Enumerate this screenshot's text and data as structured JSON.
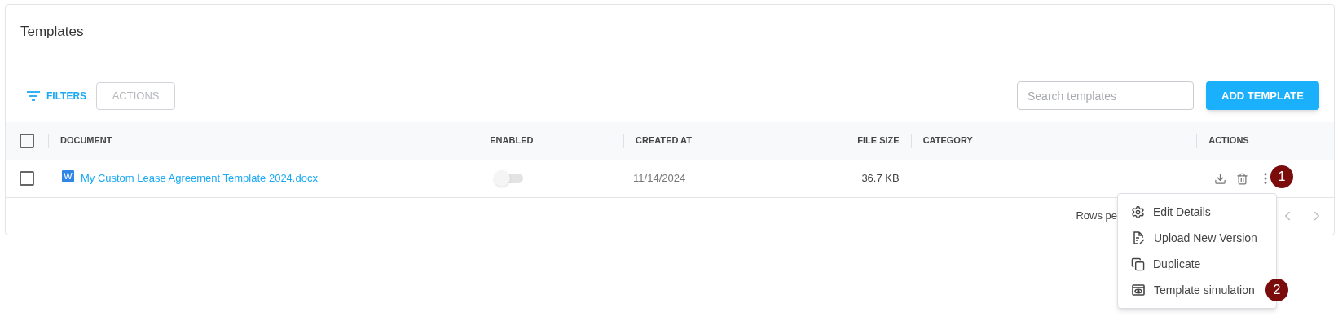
{
  "title": "Templates",
  "toolbar": {
    "filters": "FILTERS",
    "actions": {
      "label": "ACTIONS",
      "disabled": true
    },
    "search": {
      "placeholder": "Search templates"
    },
    "add_button": "ADD TEMPLATE"
  },
  "table": {
    "select_all": {
      "checked": false
    },
    "columns": [
      "DOCUMENT",
      "ENABLED",
      "CREATED AT",
      "FILE SIZE",
      "CATEGORY",
      "ACTIONS"
    ],
    "rows": [
      {
        "checked": false,
        "file_badge": "W",
        "document": "My Custom Lease Agreement Template 2024.docx",
        "enabled": false,
        "created_at": "11/14/2024",
        "file_size": "36.7 KB"
      }
    ]
  },
  "footer": {
    "rows_per_page": "Rows pe"
  },
  "menu": {
    "items": [
      "Edit Details",
      "Upload New Version",
      "Duplicate",
      "Template simulation"
    ]
  },
  "markers": [
    "1",
    "2"
  ]
}
